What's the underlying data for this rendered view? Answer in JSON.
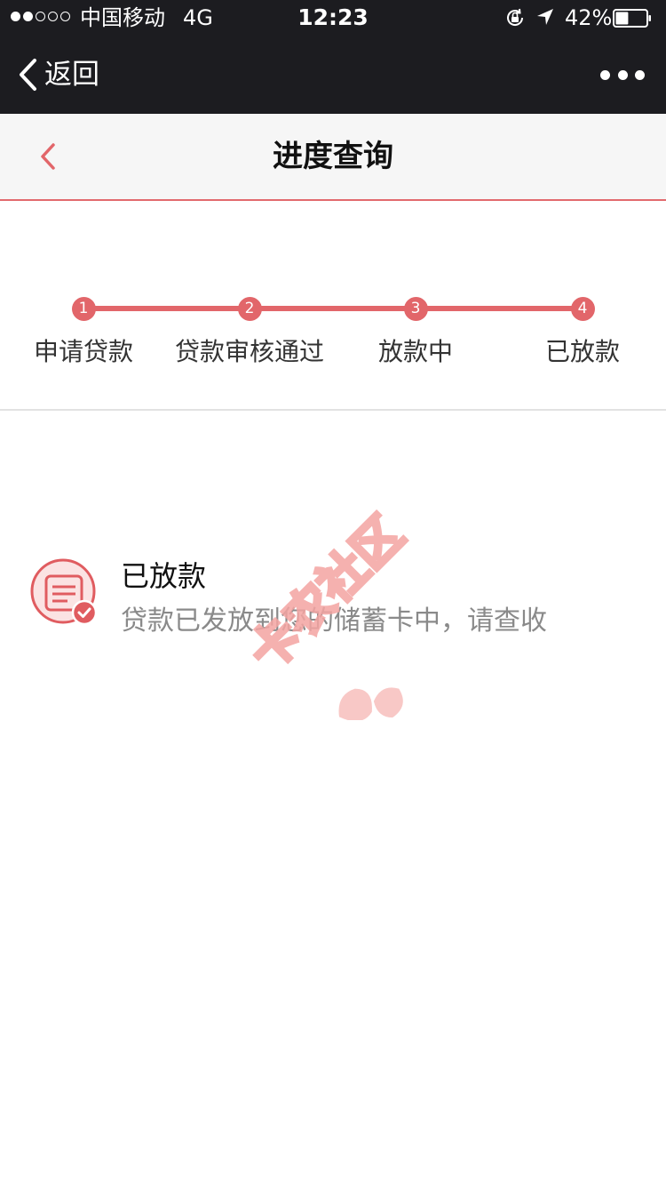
{
  "status_bar": {
    "carrier": "中国移动",
    "network": "4G",
    "time": "12:23",
    "battery_percent": "42%",
    "battery_level": 0.42,
    "signal_bars_filled": 2,
    "signal_bars_total": 5
  },
  "wechat_nav": {
    "back_label": "返回",
    "more_icon": "more-dots-icon"
  },
  "header": {
    "title": "进度查询",
    "back_icon": "chevron-left-icon"
  },
  "progress": {
    "steps": [
      {
        "number": "1",
        "label": "申请贷款"
      },
      {
        "number": "2",
        "label": "贷款审核通过"
      },
      {
        "number": "3",
        "label": "放款中"
      },
      {
        "number": "4",
        "label": "已放款"
      }
    ],
    "current_step": 4
  },
  "result": {
    "icon": "document-check-icon",
    "title": "已放款",
    "description": "贷款已发放到您的储蓄卡中，请查收"
  },
  "watermark": {
    "text": "卡农社区"
  },
  "colors": {
    "accent": "#e2666a",
    "nav_background": "#1c1c20",
    "header_background": "#f6f6f6",
    "secondary_text": "#8a8a8a"
  }
}
